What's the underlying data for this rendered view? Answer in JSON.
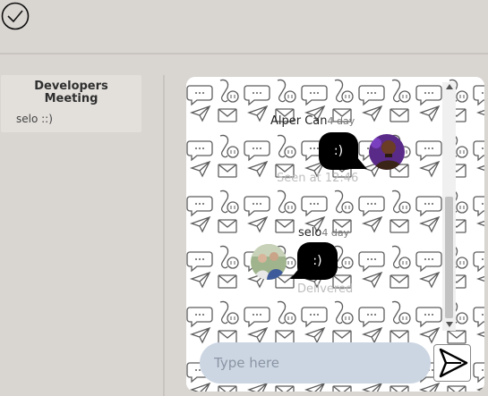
{
  "header": {
    "menu_icon": "check-circle-icon"
  },
  "sidebar": {
    "conversations": [
      {
        "title": "Developers\nMeeting",
        "preview": "selo ::)"
      }
    ]
  },
  "chat": {
    "messages": [
      {
        "sender": "Alper Can",
        "time_ago": "4 day",
        "text": ":)",
        "status": "Seen at 12:46",
        "side": "right"
      },
      {
        "sender": "selo",
        "time_ago": "4 day",
        "text": ":)",
        "status": "Delivered",
        "side": "left"
      }
    ]
  },
  "composer": {
    "placeholder": "Type here",
    "send_icon": "send-icon"
  }
}
